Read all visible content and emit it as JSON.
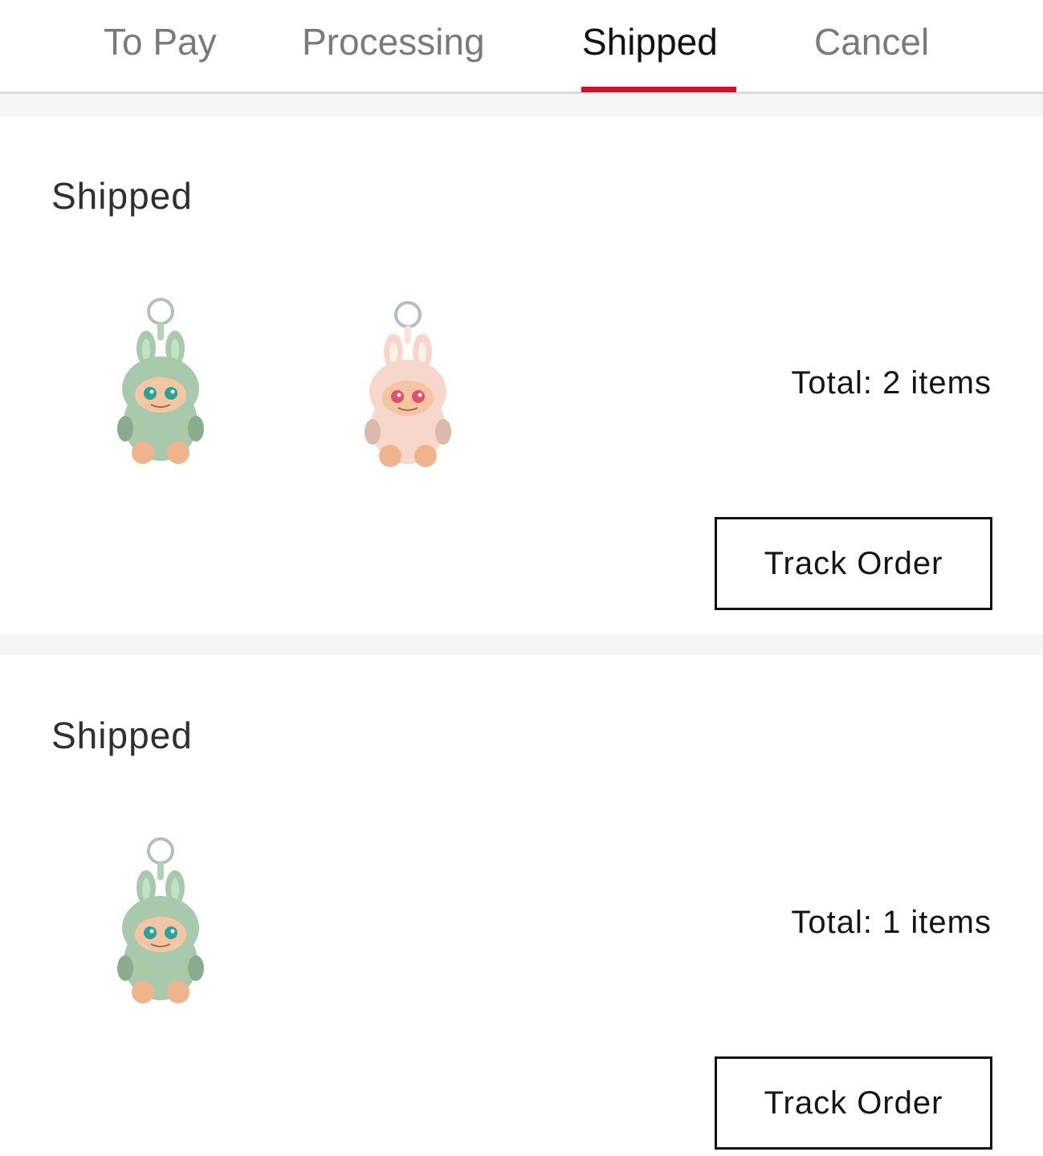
{
  "tabs": [
    {
      "label": "To Pay",
      "active": false
    },
    {
      "label": "Processing",
      "active": false
    },
    {
      "label": "Shipped",
      "active": true
    },
    {
      "label": "Cancel",
      "active": false
    }
  ],
  "accent_color": "#d0102b",
  "orders": [
    {
      "status": "Shipped",
      "total_text": "Total: 2 items",
      "button_label": "Track Order",
      "products": [
        {
          "name": "green-plush-keychain-image",
          "color": "#a9c9ad"
        },
        {
          "name": "pink-plush-keychain-image",
          "color": "#f7d7cc"
        }
      ]
    },
    {
      "status": "Shipped",
      "total_text": "Total: 1 items",
      "button_label": "Track Order",
      "products": [
        {
          "name": "green-plush-keychain-image",
          "color": "#a9c9ad"
        }
      ]
    }
  ]
}
